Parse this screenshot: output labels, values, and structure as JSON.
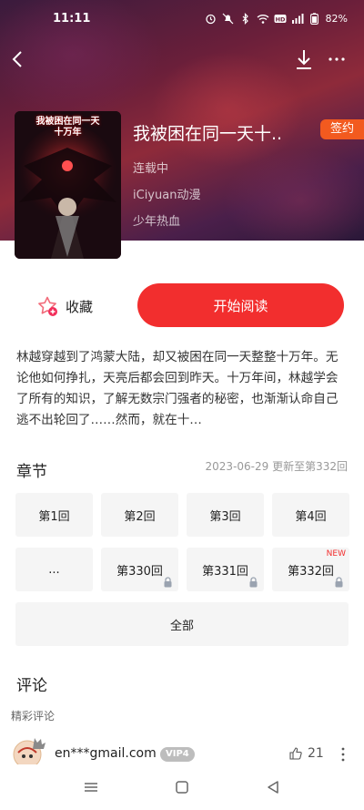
{
  "status_bar": {
    "time": "11:11",
    "icons": [
      "alarm-icon",
      "mute-icon",
      "bluetooth-icon",
      "wifi-icon",
      "hd-icon",
      "signal-icon"
    ],
    "battery": "82%"
  },
  "book": {
    "cover_text": "我被困在同一天一十万年",
    "title": "我被困在同一天十..",
    "badge": "签约",
    "status": "连载中",
    "author": "iCiyuan动漫",
    "genre": "少年热血"
  },
  "actions": {
    "collect_label": "收藏",
    "read_label": "开始阅读"
  },
  "description": "林越穿越到了鸿蒙大陆，却又被困在同一天整整十万年。无论他如何挣扎，天亮后都会回到昨天。十万年间，林越学会了所有的知识，了解无数宗门强者的秘密，也渐渐认命自己逃不出轮回了……然而，就在十…",
  "chapters": {
    "title": "章节",
    "update_info": "2023-06-29 更新至第332回",
    "row1": [
      "第1回",
      "第2回",
      "第3回",
      "第4回"
    ],
    "row2": [
      "...",
      "第330回",
      "第331回",
      "第332回"
    ],
    "new_tag": "NEW",
    "all_label": "全部"
  },
  "comments": {
    "title": "评论",
    "subtitle": "精彩评论",
    "items": [
      {
        "user": "en***gmail.com",
        "vip": "VIP4",
        "likes": "21"
      }
    ]
  },
  "colors": {
    "accent": "#f22e2e",
    "badge": "#f25a1f"
  }
}
